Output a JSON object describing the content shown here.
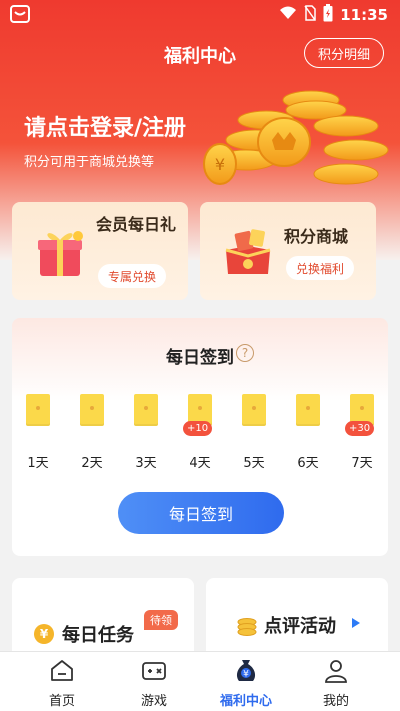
{
  "status_bar": {
    "time": "11:35"
  },
  "header": {
    "title": "福利中心",
    "points_detail_label": "积分明细",
    "login_prompt": "请点击登录/注册",
    "login_sub": "积分可用于商城兑换等"
  },
  "cards": [
    {
      "title": "会员每日礼",
      "button": "专属兑换",
      "icon": "gift-box-icon"
    },
    {
      "title": "积分商城",
      "button": "兑换福利",
      "icon": "gift-bag-icon"
    }
  ],
  "daily_signin": {
    "title": "每日签到",
    "help_icon": "?",
    "days": [
      {
        "label": "1天",
        "bonus": ""
      },
      {
        "label": "2天",
        "bonus": ""
      },
      {
        "label": "3天",
        "bonus": ""
      },
      {
        "label": "4天",
        "bonus": "+10"
      },
      {
        "label": "5天",
        "bonus": ""
      },
      {
        "label": "6天",
        "bonus": ""
      },
      {
        "label": "7天",
        "bonus": "+30"
      }
    ],
    "button_label": "每日签到"
  },
  "tasks": {
    "daily_task": {
      "title": "每日任务",
      "badge": "待领",
      "icon": "¥"
    },
    "review": {
      "title": "点评活动",
      "icon": "coin-stack-icon"
    }
  },
  "tabbar": [
    {
      "label": "首页",
      "icon": "home-icon",
      "active": false
    },
    {
      "label": "游戏",
      "icon": "gamepad-icon",
      "active": false
    },
    {
      "label": "福利中心",
      "icon": "money-bag-icon",
      "active": true
    },
    {
      "label": "我的",
      "icon": "user-icon",
      "active": false
    }
  ],
  "colors": {
    "primary_red": "#ef3a2f",
    "primary_blue": "#2f6bee",
    "card_bg": "#fde9d2",
    "envelope": "#fbd94a"
  }
}
